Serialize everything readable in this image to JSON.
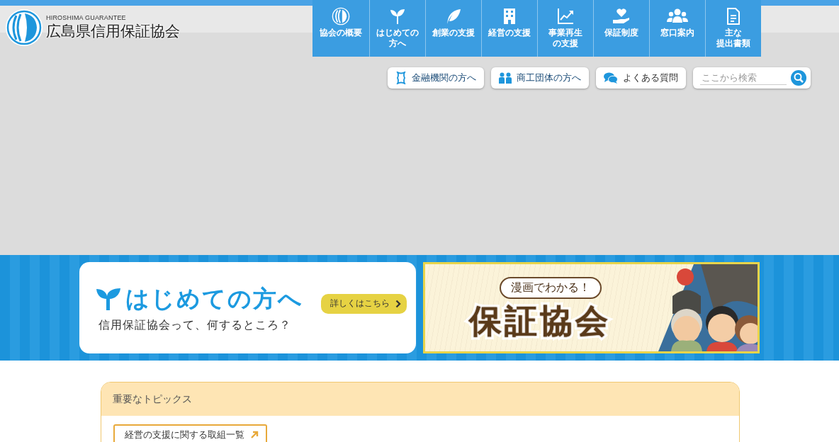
{
  "logo": {
    "subtitle": "HIROSHIMA GUARANTEE",
    "name": "広島県信用保証協会"
  },
  "nav": [
    {
      "lines": [
        "協会の概要"
      ]
    },
    {
      "lines": [
        "はじめての",
        "方へ"
      ]
    },
    {
      "lines": [
        "創業の支援"
      ]
    },
    {
      "lines": [
        "経営の支援"
      ]
    },
    {
      "lines": [
        "事業再生",
        "の支援"
      ]
    },
    {
      "lines": [
        "保証制度"
      ]
    },
    {
      "lines": [
        "窓口案内"
      ]
    },
    {
      "lines": [
        "主な",
        "提出書類"
      ]
    }
  ],
  "utility_links": [
    {
      "label": "金融機関の方へ"
    },
    {
      "label": "商工団体の方へ"
    },
    {
      "label": "よくある質問"
    }
  ],
  "search": {
    "placeholder": "ここから検索"
  },
  "promo": {
    "title": "はじめての方へ",
    "subtitle": "信用保証協会って、何するところ？",
    "button": "詳しくはこちら"
  },
  "manga_banner": {
    "bubble": "漫画でわかる！",
    "title": "保証協会"
  },
  "topics": {
    "heading": "重要なトピックス",
    "links": [
      "経営の支援に関する取組一覧"
    ]
  }
}
